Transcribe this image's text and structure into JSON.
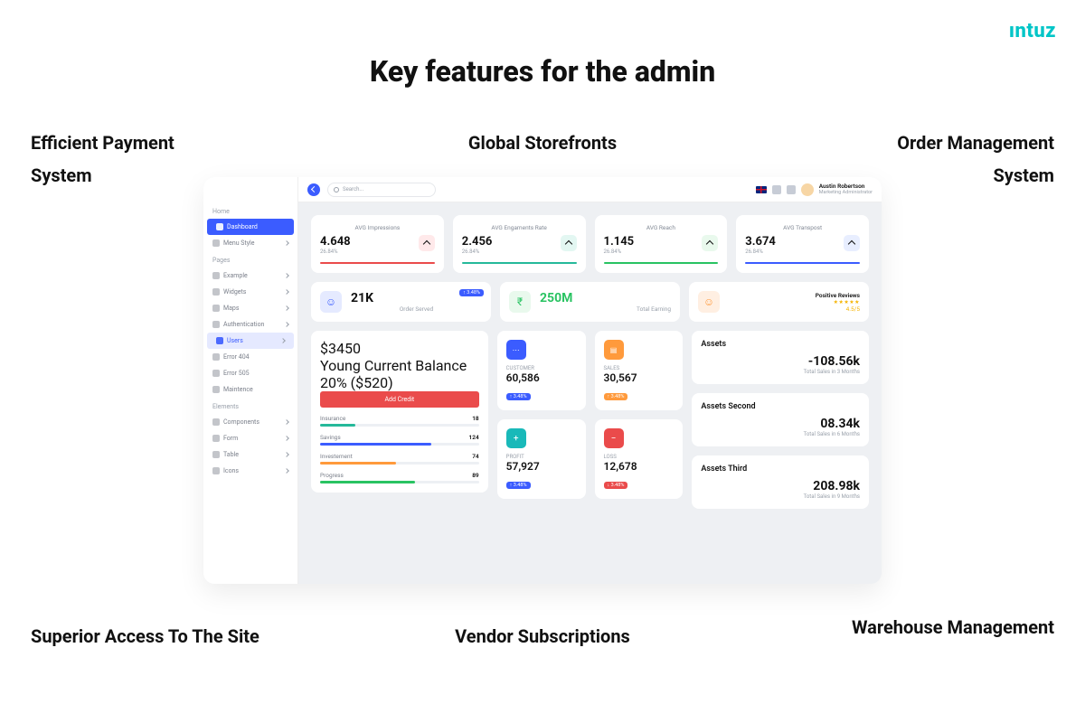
{
  "brand": "ıntuz",
  "page_title": "Key features for the admin",
  "features": {
    "top_left": "Efficient Payment System",
    "top_center": "Global Storefronts",
    "top_right": "Order Management System",
    "bottom_left": "Superior Access To The Site",
    "bottom_center": "Vendor Subscriptions",
    "bottom_right": "Warehouse Management"
  },
  "topbar": {
    "search_placeholder": "Search...",
    "user_name": "Austin Robertson",
    "user_role": "Marketing Administrator"
  },
  "sidebar": {
    "sections": {
      "home": "Home",
      "pages": "Pages",
      "elements": "Elements"
    },
    "items": [
      {
        "label": "Dashboard",
        "state": "active"
      },
      {
        "label": "Menu Style",
        "state": ""
      },
      {
        "label": "Example",
        "state": ""
      },
      {
        "label": "Widgets",
        "state": ""
      },
      {
        "label": "Maps",
        "state": ""
      },
      {
        "label": "Authentication",
        "state": ""
      },
      {
        "label": "Users",
        "state": "selected"
      },
      {
        "label": "Error 404",
        "state": ""
      },
      {
        "label": "Error 505",
        "state": ""
      },
      {
        "label": "Maintence",
        "state": ""
      },
      {
        "label": "Components",
        "state": ""
      },
      {
        "label": "Form",
        "state": ""
      },
      {
        "label": "Table",
        "state": ""
      },
      {
        "label": "Icons",
        "state": ""
      }
    ]
  },
  "kpis": [
    {
      "title": "AVG Impressions",
      "value": "4.648",
      "pct": "26.84%",
      "color": "red"
    },
    {
      "title": "AVG Engaments Rate",
      "value": "2.456",
      "pct": "26.84%",
      "color": "teal"
    },
    {
      "title": "AVG Reach",
      "value": "1.145",
      "pct": "26.84%",
      "color": "green"
    },
    {
      "title": "AVG Transpost",
      "value": "3.674",
      "pct": "26.84%",
      "color": "blue"
    }
  ],
  "stats": [
    {
      "value": "21K",
      "label": "Order Served",
      "badge": "↑ 3.48%"
    },
    {
      "value": "250M",
      "label": "Total Earning"
    },
    {
      "title": "Positive Reviews",
      "rating": "4.5/5",
      "stars": "★★★★★"
    }
  ],
  "balance": {
    "amount": "$3450",
    "title": "Young Current Balance",
    "sub": "20% ($520)",
    "button": "Add Credit",
    "bars": [
      {
        "label": "Insurance",
        "value": "18",
        "color": "#25b99a",
        "pct": 22
      },
      {
        "label": "Savings",
        "value": "124",
        "color": "#3b5cff",
        "pct": 70
      },
      {
        "label": "Investement",
        "value": "74",
        "color": "#ff9a3c",
        "pct": 48
      },
      {
        "label": "Progress",
        "value": "89",
        "color": "#29c362",
        "pct": 60
      }
    ]
  },
  "small_cards_left": [
    {
      "label": "CUSTOMER",
      "value": "60,586",
      "chip": "chip-blue",
      "tag": "↑ 3.48%",
      "tagClass": "tag-blue"
    },
    {
      "label": "PROFIT",
      "value": "57,927",
      "chip": "chip-teal",
      "tag": "↑ 3.48%",
      "tagClass": "tag-blue"
    }
  ],
  "small_cards_right": [
    {
      "label": "SALES",
      "value": "30,567",
      "chip": "chip-orange",
      "tag": "↑ 3.48%",
      "tagClass": "tag-orange"
    },
    {
      "label": "LOSS",
      "value": "12,678",
      "chip": "chip-red",
      "tag": "↓ 3.48%",
      "tagClass": "tag-red"
    }
  ],
  "assets": [
    {
      "title": "Assets",
      "value": "-108.56k",
      "sub": "Total Sales in 3 Months"
    },
    {
      "title": "Assets Second",
      "value": "08.34k",
      "sub": "Total Sales in 6 Months"
    },
    {
      "title": "Assets Third",
      "value": "208.98k",
      "sub": "Total Sales in 9 Months"
    }
  ]
}
